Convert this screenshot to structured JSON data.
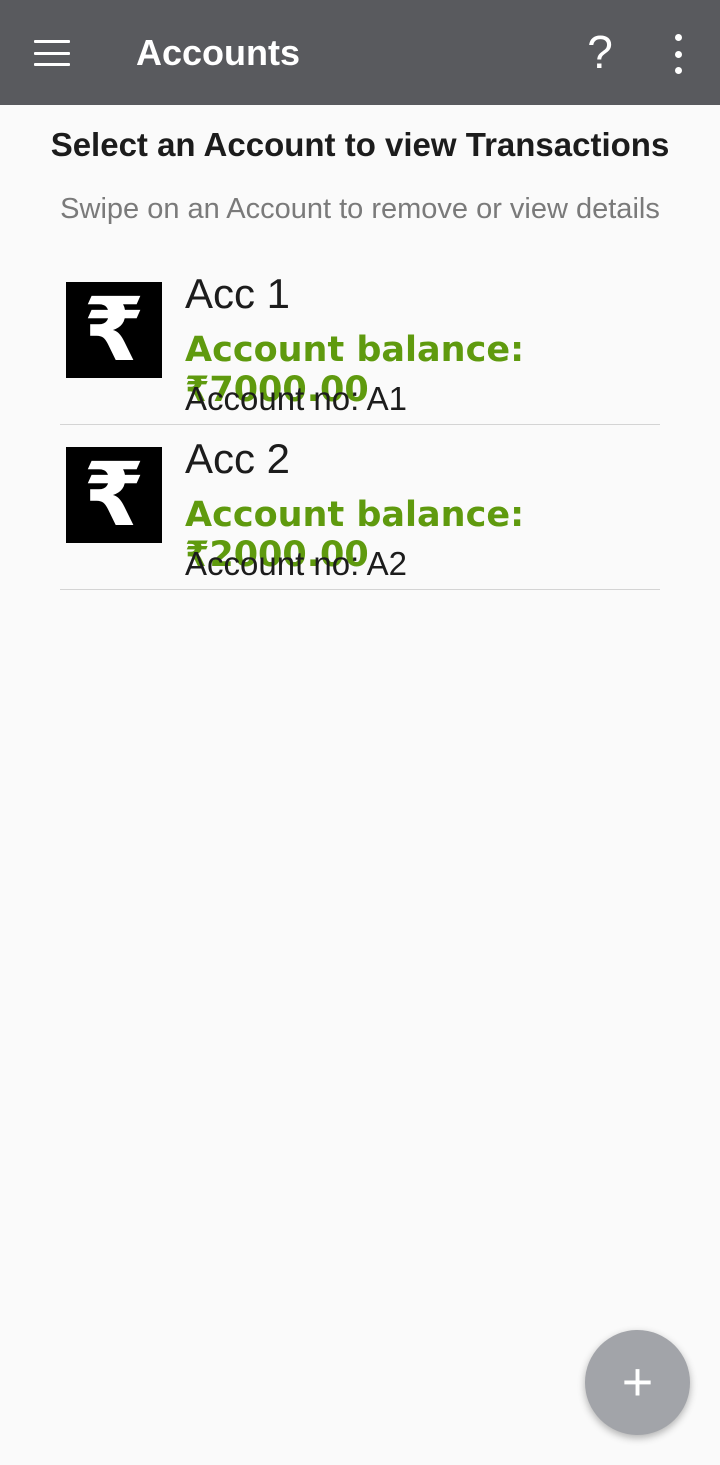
{
  "app_bar": {
    "menu_icon": "hamburger-menu-icon",
    "title": "Accounts",
    "help_label": "?",
    "overflow_icon": "more-vert-icon",
    "background": "#595a5e"
  },
  "header": {
    "heading": "Select an Account to view Transactions",
    "subheading": "Swipe on an Account to remove or view details"
  },
  "accounts": [
    {
      "icon": "rupee-icon",
      "icon_glyph": "₹",
      "name": "Acc 1",
      "balance": "Account balance: ₹7000.00",
      "account_no": "Account no: A1"
    },
    {
      "icon": "rupee-icon",
      "icon_glyph": "₹",
      "name": "Acc 2",
      "balance": "Account balance: ₹2000.00",
      "account_no": "Account no: A2"
    }
  ],
  "colors": {
    "balance": "#5f9a0e",
    "fab": "#a2a4a9"
  },
  "fab": {
    "icon": "add-icon",
    "label": "+"
  }
}
